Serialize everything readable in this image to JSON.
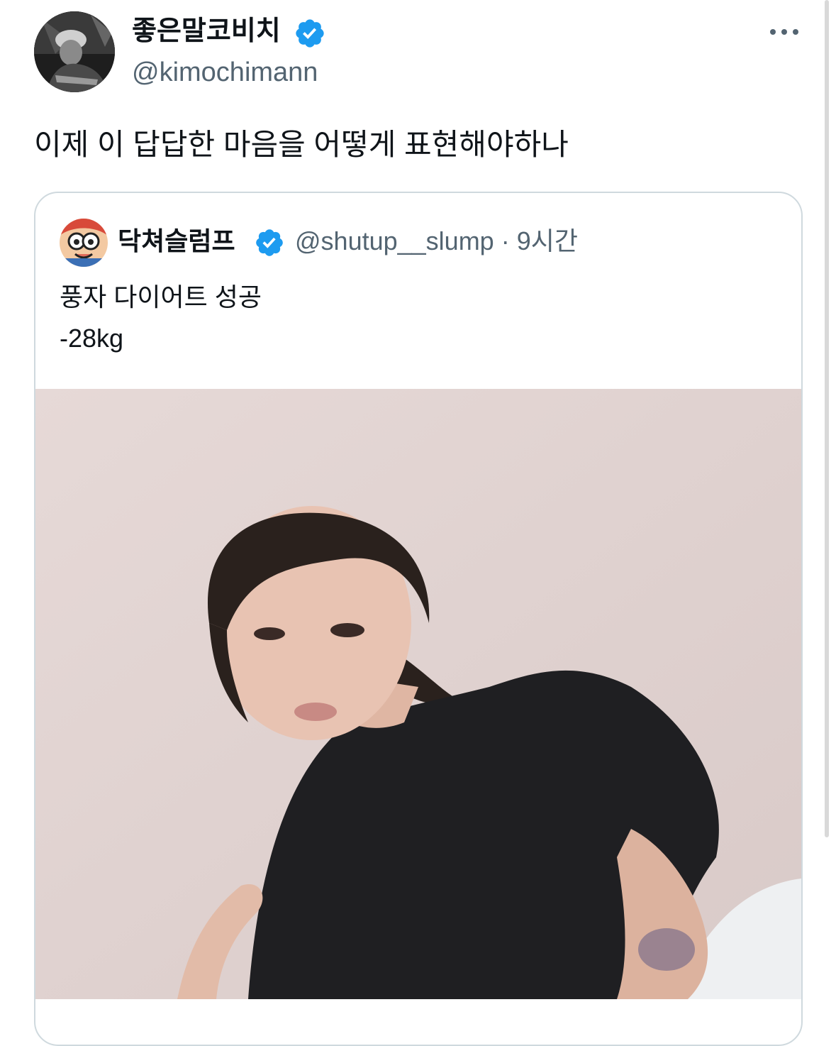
{
  "tweet": {
    "author": {
      "display_name": "좋은말코비치",
      "handle": "@kimochimann",
      "verified": true
    },
    "text": "이제 이 답답한 마음을 어떻게 표현해야하나",
    "more_icon": "more-horizontal-icon"
  },
  "quoted_tweet": {
    "author": {
      "display_name": "닥쳐슬럼프",
      "handle": "@shutup__slump",
      "verified": true
    },
    "separator": "·",
    "time": "9시간",
    "text_lines": [
      "풍자 다이어트 성공",
      "-28kg"
    ],
    "media_type": "photo"
  },
  "colors": {
    "verified_badge": "#1d9bf0",
    "secondary_text": "#536471",
    "border": "#cfd9de"
  }
}
